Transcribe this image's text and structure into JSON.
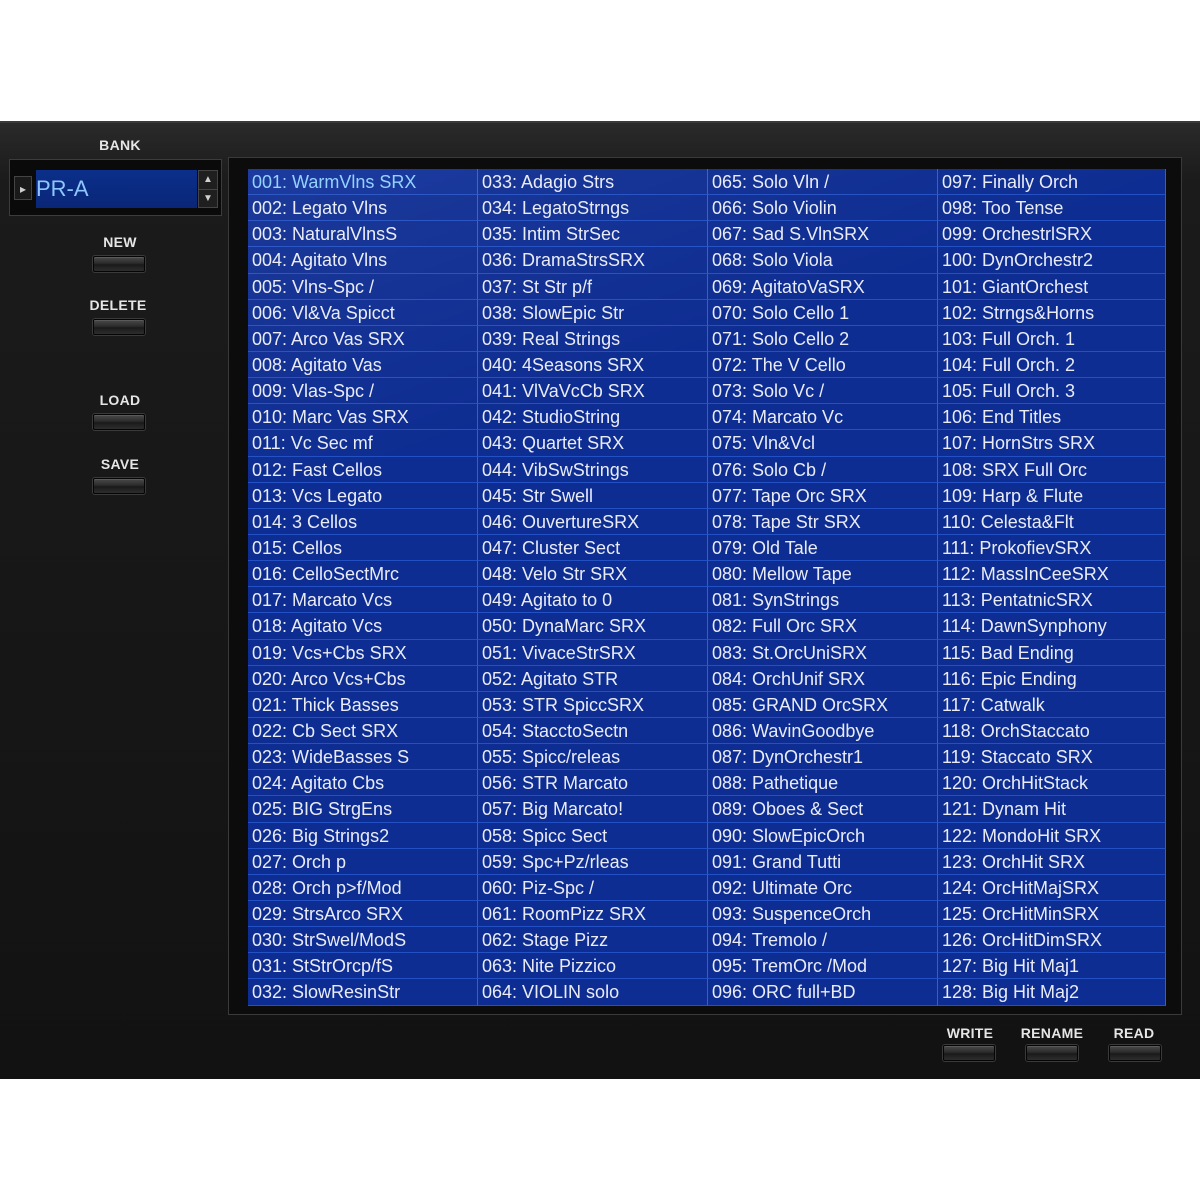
{
  "bank": {
    "label": "BANK",
    "value": "PR-A",
    "up_icon": "triangle-up",
    "down_icon": "triangle-down",
    "left_icon": "triangle-right"
  },
  "left_buttons": {
    "new": "NEW",
    "delete": "DELETE",
    "load": "LOAD",
    "save": "SAVE"
  },
  "bottom_buttons": {
    "write": "WRITE",
    "rename": "RENAME",
    "read": "READ"
  },
  "selected_index": 0,
  "patches": [
    "001: WarmVlns SRX",
    "002: Legato Vlns",
    "003: NaturalVlnsS",
    "004: Agitato Vlns",
    "005: Vlns-Spc /",
    "006: Vl&Va Spicct",
    "007: Arco Vas SRX",
    "008: Agitato Vas",
    "009: Vlas-Spc /",
    "010: Marc Vas SRX",
    "011: Vc Sec mf",
    "012: Fast Cellos",
    "013: Vcs Legato",
    "014: 3 Cellos",
    "015: Cellos",
    "016: CelloSectMrc",
    "017: Marcato Vcs",
    "018: Agitato Vcs",
    "019: Vcs+Cbs SRX",
    "020: Arco Vcs+Cbs",
    "021: Thick Basses",
    "022: Cb Sect SRX",
    "023: WideBasses S",
    "024: Agitato Cbs",
    "025: BIG StrgEns",
    "026: Big Strings2",
    "027: Orch p",
    "028: Orch p>f/Mod",
    "029: StrsArco SRX",
    "030: StrSwel/ModS",
    "031: StStrOrcp/fS",
    "032: SlowResinStr",
    "033: Adagio Strs",
    "034: LegatoStrngs",
    "035: Intim StrSec",
    "036: DramaStrsSRX",
    "037: St Str p/f",
    "038: SlowEpic Str",
    "039: Real Strings",
    "040: 4Seasons SRX",
    "041: VlVaVcCb SRX",
    "042: StudioString",
    "043: Quartet SRX",
    "044: VibSwStrings",
    "045: Str Swell",
    "046: OuvertureSRX",
    "047: Cluster Sect",
    "048: Velo Str SRX",
    "049: Agitato to 0",
    "050: DynaMarc SRX",
    "051: VivaceStrSRX",
    "052: Agitato STR",
    "053: STR SpiccSRX",
    "054: StacctoSectn",
    "055: Spicc/releas",
    "056: STR Marcato",
    "057: Big Marcato!",
    "058: Spicc Sect",
    "059: Spc+Pz/rleas",
    "060: Piz-Spc /",
    "061: RoomPizz SRX",
    "062: Stage Pizz",
    "063: Nite Pizzico",
    "064: VIOLIN solo",
    "065: Solo Vln /",
    "066: Solo Violin",
    "067: Sad S.VlnSRX",
    "068: Solo Viola",
    "069: AgitatoVaSRX",
    "070: Solo Cello 1",
    "071: Solo Cello 2",
    "072: The V Cello",
    "073: Solo Vc /",
    "074: Marcato Vc",
    "075: Vln&Vcl",
    "076: Solo Cb /",
    "077: Tape Orc SRX",
    "078: Tape Str SRX",
    "079: Old Tale",
    "080: Mellow Tape",
    "081: SynStrings",
    "082: Full Orc SRX",
    "083: St.OrcUniSRX",
    "084: OrchUnif SRX",
    "085: GRAND OrcSRX",
    "086: WavinGoodbye",
    "087: DynOrchestr1",
    "088: Pathetique",
    "089: Oboes & Sect",
    "090: SlowEpicOrch",
    "091: Grand Tutti",
    "092: Ultimate Orc",
    "093: SuspenceOrch",
    "094: Tremolo /",
    "095: TremOrc /Mod",
    "096: ORC full+BD",
    "097: Finally Orch",
    "098: Too Tense",
    "099: OrchestrlSRX",
    "100: DynOrchestr2",
    "101: GiantOrchest",
    "102: Strngs&Horns",
    "103: Full Orch. 1",
    "104: Full Orch. 2",
    "105: Full Orch. 3",
    "106: End Titles",
    "107: HornStrs SRX",
    "108: SRX Full Orc",
    "109: Harp & Flute",
    "110: Celesta&Flt",
    "111: ProkofievSRX",
    "112: MassInCeeSRX",
    "113: PentatnicSRX",
    "114: DawnSynphony",
    "115: Bad Ending",
    "116: Epic Ending",
    "117: Catwalk",
    "118: OrchStaccato",
    "119: Staccato SRX",
    "120: OrchHitStack",
    "121: Dynam Hit",
    "122: MondoHit SRX",
    "123: OrchHit SRX",
    "124: OrcHitMajSRX",
    "125: OrcHitMinSRX",
    "126: OrcHitDimSRX",
    "127: Big Hit Maj1",
    "128: Big Hit Maj2"
  ]
}
